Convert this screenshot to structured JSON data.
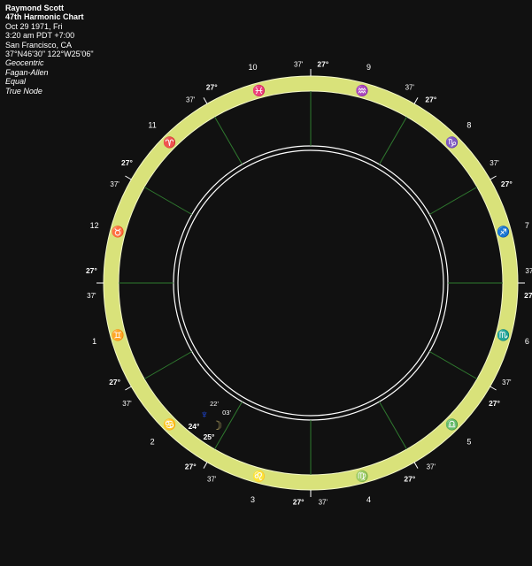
{
  "header": {
    "name": "Raymond Scott",
    "chart_title": "47th Harmonic Chart",
    "date": "Oct 29 1971, Fri",
    "time": "3:20 am  PDT +7:00",
    "place": "San Francisco, CA",
    "coords": "37°N46'30\" 122°W25'06\"",
    "zodiac": "Geocentric",
    "ayanamsa": "Fagan-Allen",
    "houses": "Equal",
    "node": "True Node"
  },
  "colors": {
    "background": "#111111",
    "band": "#d9e27a",
    "house_lines": "#2f7a2f",
    "text": "#ffffff"
  },
  "cusp_labels": {
    "degree": "27°",
    "minute": "37'"
  },
  "houses": [
    {
      "num": "1",
      "sign": "gemini",
      "glyph": "♊",
      "color": "#e0e000"
    },
    {
      "num": "2",
      "sign": "cancer",
      "glyph": "♋",
      "color": "#00d000"
    },
    {
      "num": "3",
      "sign": "leo",
      "glyph": "♌",
      "color": "#00b000"
    },
    {
      "num": "4",
      "sign": "virgo",
      "glyph": "♍",
      "color": "#00b000"
    },
    {
      "num": "5",
      "sign": "libra",
      "glyph": "♎",
      "color": "#00d0d0"
    },
    {
      "num": "6",
      "sign": "scorpio",
      "glyph": "♏",
      "color": "#0090ff"
    },
    {
      "num": "7",
      "sign": "sagittarius",
      "glyph": "♐",
      "color": "#5060ff"
    },
    {
      "num": "8",
      "sign": "capricorn",
      "glyph": "♑",
      "color": "#8040ff"
    },
    {
      "num": "9",
      "sign": "aquarius",
      "glyph": "♒",
      "color": "#c030c0"
    },
    {
      "num": "10",
      "sign": "pisces",
      "glyph": "♓",
      "color": "#e00080"
    },
    {
      "num": "11",
      "sign": "aries",
      "glyph": "♈",
      "color": "#e00000"
    },
    {
      "num": "12",
      "sign": "taurus",
      "glyph": "♉",
      "color": "#d07000"
    }
  ],
  "planets": [
    {
      "name": "neptune",
      "glyph": "♆",
      "color": "#2050ff",
      "degree": "24°",
      "minute": "22'"
    },
    {
      "name": "moon",
      "glyph": "☽",
      "color": "#b0a060",
      "degree": "25°",
      "minute": "03'"
    }
  ]
}
